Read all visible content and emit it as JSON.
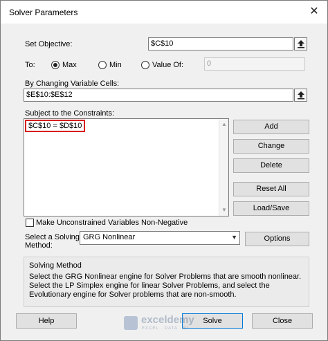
{
  "window": {
    "title": "Solver Parameters",
    "close_glyph": "✕"
  },
  "objective": {
    "label": "Set Objective:",
    "value": "$C$10"
  },
  "to": {
    "label": "To:",
    "options": [
      {
        "label": "Max",
        "selected": true
      },
      {
        "label": "Min",
        "selected": false
      },
      {
        "label": "Value Of:",
        "selected": false
      }
    ],
    "value_of": "0"
  },
  "changing_cells": {
    "label": "By Changing Variable Cells:",
    "value": "$E$10:$E$12"
  },
  "constraints": {
    "label": "Subject to the Constraints:",
    "items": [
      "$C$10 = $D$10"
    ],
    "buttons": {
      "add": "Add",
      "change": "Change",
      "delete": "Delete",
      "reset_all": "Reset All",
      "load_save": "Load/Save"
    }
  },
  "non_negative": {
    "label": "Make Unconstrained Variables Non-Negative",
    "checked": false
  },
  "method": {
    "label_line1": "Select a Solving",
    "label_line2": "Method:",
    "value": "GRG Nonlinear",
    "options_button": "Options"
  },
  "solving_method": {
    "title": "Solving Method",
    "text": "Select the GRG Nonlinear engine for Solver Problems that are smooth nonlinear. Select the LP Simplex engine for linear Solver Problems, and select the Evolutionary engine for Solver problems that are non-smooth."
  },
  "footer": {
    "help": "Help",
    "solve": "Solve",
    "close": "Close"
  },
  "watermark": {
    "name": "exceldemy",
    "tagline": "EXCEL · DATA · BI"
  },
  "colors": {
    "highlight": "#d81e1e",
    "default_button": "#0078d7"
  }
}
